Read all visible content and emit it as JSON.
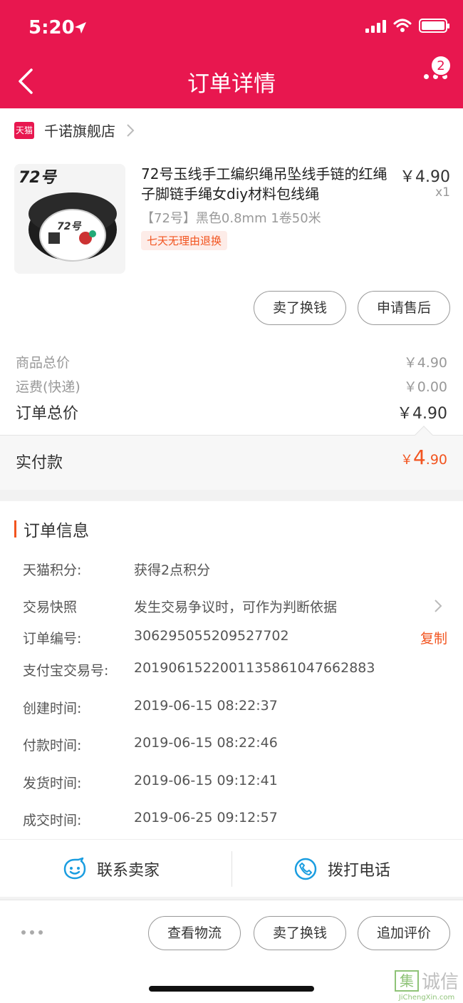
{
  "status_bar": {
    "time": "5:20"
  },
  "header": {
    "title": "订单详情",
    "badge": "2"
  },
  "shop": {
    "logo_text": "天猫",
    "name": "千诺旗舰店"
  },
  "product": {
    "title": "72号玉线手工编织绳吊坠线手链的红绳子脚链手绳女diy材料包线绳",
    "price": "￥4.90",
    "qty": "x1",
    "spec": "【72号】黑色0.8mm 1卷50米",
    "return_tag": "七天无理由退换",
    "actions": {
      "sell": "卖了换钱",
      "aftersale": "申请售后"
    }
  },
  "summary": {
    "goods_label": "商品总价",
    "goods_value": "￥4.90",
    "shipping_label": "运费(快递)",
    "shipping_value": "￥0.00",
    "total_label": "订单总价",
    "total_value": "￥4.90",
    "paid_label": "实付款",
    "paid_currency": "￥",
    "paid_int": "4",
    "paid_dec": ".90"
  },
  "order_info": {
    "title": "订单信息",
    "rows": [
      {
        "label": "天猫积分:",
        "value": "获得2点积分"
      },
      {
        "label": "交易快照",
        "value": "发生交易争议时，可作为判断依据"
      },
      {
        "label": "订单编号:",
        "value": "306295055209527702"
      },
      {
        "label": "支付宝交易号:",
        "value": "2019061522001135861047662883"
      },
      {
        "label": "创建时间:",
        "value": "2019-06-15 08:22:37"
      },
      {
        "label": "付款时间:",
        "value": "2019-06-15 08:22:46"
      },
      {
        "label": "发货时间:",
        "value": "2019-06-15 09:12:41"
      },
      {
        "label": "成交时间:",
        "value": "2019-06-25 09:12:57"
      }
    ],
    "copy_label": "复制",
    "contact_seller": "联系卖家",
    "call": "拨打电话"
  },
  "bottom_actions": {
    "logistics": "查看物流",
    "sell": "卖了换钱",
    "review": "追加评价"
  },
  "watermark": {
    "text": "诚信",
    "box": "集",
    "sub": "JiChengXin.com"
  },
  "colors": {
    "brand": "#e8174f",
    "accent": "#f2541f",
    "link": "#1a9de0"
  }
}
